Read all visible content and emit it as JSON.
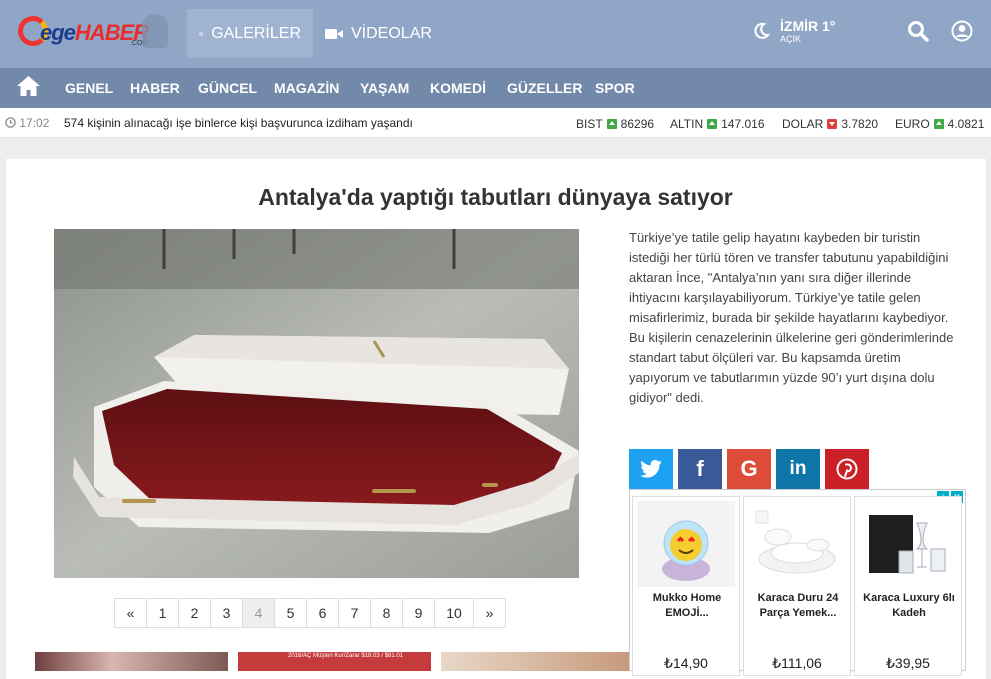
{
  "header": {
    "logo": {
      "text_ege": "ege",
      "text_haber": "HABER",
      "text_com": ".COM"
    },
    "tabs": [
      {
        "label": "GALERİLER",
        "icon": "camera-icon"
      },
      {
        "label": "VİDEOLAR",
        "icon": "video-icon"
      }
    ],
    "weather": {
      "city": "İZMİR 1°",
      "condition": "AÇIK",
      "icon": "weather-moon-icon"
    }
  },
  "menu": {
    "items": [
      "GENEL",
      "HABER",
      "GÜNCEL",
      "MAGAZİN",
      "YAŞAM",
      "KOMEDİ",
      "GÜZELLER",
      "SPOR"
    ]
  },
  "ticker": {
    "time": "17:02",
    "headline": "574 kişinin alınacağı işe binlerce kişi başvurunca izdiham yaşandı",
    "markets": [
      {
        "name": "BIST",
        "value": "86296",
        "trend": "up"
      },
      {
        "name": "ALTIN",
        "value": "147.016",
        "trend": "up"
      },
      {
        "name": "DOLAR",
        "value": "3.7820",
        "trend": "down"
      },
      {
        "name": "EURO",
        "value": "4.0821",
        "trend": "up"
      }
    ]
  },
  "article": {
    "title": "Antalya'da yaptığı tabutları dünyaya satıyor",
    "body": "Türkiye’ye tatile gelip hayatını kaybeden bir turistin istediği her türlü tören ve transfer tabutunu yapabildiğini aktaran İnce, \"Antalya’nın yanı sıra diğer illerinde ihtiyacını karşılayabiliyorum. Türkiye’ye tatile gelen misafirlerimiz, burada bir şekilde hayatlarını kaybediyor. Bu kişilerin cenazelerinin ülkelerine geri gönderimlerinde standart tabut ölçüleri var. Bu kapsamda üretim yapıyorum ve tabutlarımın yüzde 90’ı yurt dışına dolu gidiyor\" dedi."
  },
  "pager": {
    "prev": "«",
    "pages": [
      "1",
      "2",
      "3",
      "4",
      "5",
      "6",
      "7",
      "8",
      "9",
      "10"
    ],
    "current": "4",
    "next": "»"
  },
  "share": [
    {
      "network": "twitter",
      "color": "#1da1f2"
    },
    {
      "network": "facebook",
      "color": "#3b5998"
    },
    {
      "network": "google",
      "color": "#dd4b39"
    },
    {
      "network": "linkedin",
      "color": "#0e76a8"
    },
    {
      "network": "pinterest",
      "color": "#cb2027"
    }
  ],
  "ads": [
    {
      "name": "Mukko Home EMOJİ...",
      "price": "₺14,90"
    },
    {
      "name": "Karaca Duru 24 Parça Yemek...",
      "price": "₺111,06"
    },
    {
      "name": "Karaca Luxury 6lı Kadeh",
      "price": "₺39,95"
    }
  ],
  "thumb_caption": "2016/AÇ Müşteri Kur/Zarar $18.03 / $81.01"
}
